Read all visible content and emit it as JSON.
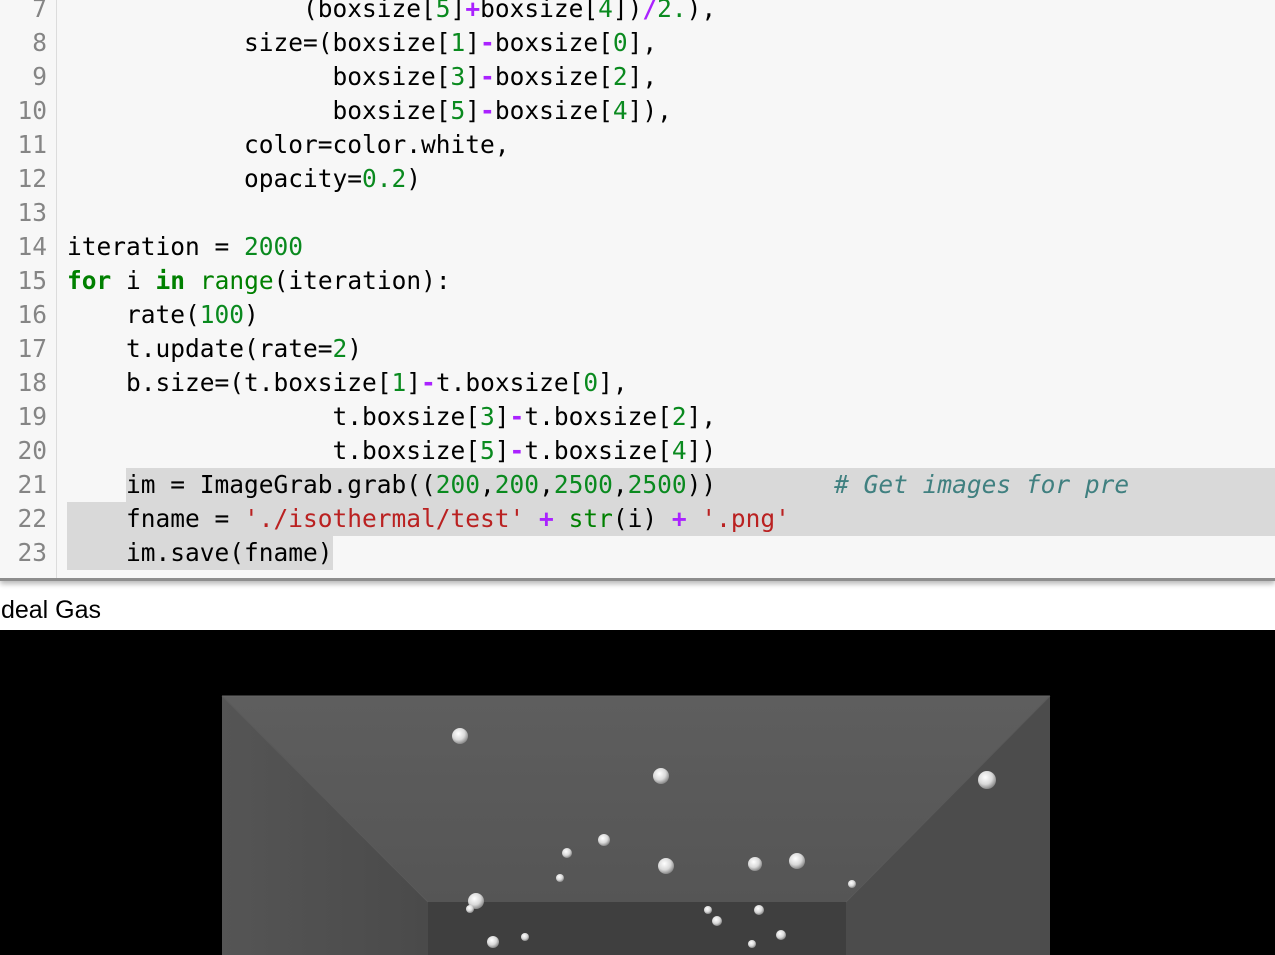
{
  "editor": {
    "lines": [
      {
        "num": "7",
        "tokens": [
          {
            "t": "                "
          },
          {
            "t": "(boxsize["
          },
          {
            "t": "5",
            "c": "n"
          },
          {
            "t": "]"
          },
          {
            "t": "+",
            "c": "o"
          },
          {
            "t": "boxsize["
          },
          {
            "t": "4",
            "c": "n"
          },
          {
            "t": "])"
          },
          {
            "t": "/",
            "c": "o"
          },
          {
            "t": "2.",
            "c": "n"
          },
          {
            "t": "),"
          }
        ]
      },
      {
        "num": "8",
        "tokens": [
          {
            "t": "            size=(boxsize["
          },
          {
            "t": "1",
            "c": "n"
          },
          {
            "t": "]"
          },
          {
            "t": "-",
            "c": "o"
          },
          {
            "t": "boxsize["
          },
          {
            "t": "0",
            "c": "n"
          },
          {
            "t": "],"
          }
        ]
      },
      {
        "num": "9",
        "tokens": [
          {
            "t": "                  boxsize["
          },
          {
            "t": "3",
            "c": "n"
          },
          {
            "t": "]"
          },
          {
            "t": "-",
            "c": "o"
          },
          {
            "t": "boxsize["
          },
          {
            "t": "2",
            "c": "n"
          },
          {
            "t": "],"
          }
        ]
      },
      {
        "num": "10",
        "tokens": [
          {
            "t": "                  boxsize["
          },
          {
            "t": "5",
            "c": "n"
          },
          {
            "t": "]"
          },
          {
            "t": "-",
            "c": "o"
          },
          {
            "t": "boxsize["
          },
          {
            "t": "4",
            "c": "n"
          },
          {
            "t": "]),"
          }
        ]
      },
      {
        "num": "11",
        "tokens": [
          {
            "t": "            color=color.white,"
          }
        ]
      },
      {
        "num": "12",
        "tokens": [
          {
            "t": "            opacity="
          },
          {
            "t": "0.2",
            "c": "n"
          },
          {
            "t": ")"
          }
        ]
      },
      {
        "num": "13",
        "tokens": []
      },
      {
        "num": "14",
        "tokens": [
          {
            "t": "iteration = "
          },
          {
            "t": "2000",
            "c": "n"
          }
        ]
      },
      {
        "num": "15",
        "tokens": [
          {
            "t": "for",
            "c": "k"
          },
          {
            "t": " i "
          },
          {
            "t": "in",
            "c": "k"
          },
          {
            "t": " "
          },
          {
            "t": "range",
            "c": "b"
          },
          {
            "t": "(iteration):"
          }
        ]
      },
      {
        "num": "16",
        "tokens": [
          {
            "t": "    rate("
          },
          {
            "t": "100",
            "c": "n"
          },
          {
            "t": ")"
          }
        ]
      },
      {
        "num": "17",
        "tokens": [
          {
            "t": "    t.update(rate="
          },
          {
            "t": "2",
            "c": "n"
          },
          {
            "t": ")"
          }
        ]
      },
      {
        "num": "18",
        "tokens": [
          {
            "t": "    b.size=(t.boxsize["
          },
          {
            "t": "1",
            "c": "n"
          },
          {
            "t": "]"
          },
          {
            "t": "-",
            "c": "o"
          },
          {
            "t": "t.boxsize["
          },
          {
            "t": "0",
            "c": "n"
          },
          {
            "t": "],"
          }
        ]
      },
      {
        "num": "19",
        "tokens": [
          {
            "t": "                  t.boxsize["
          },
          {
            "t": "3",
            "c": "n"
          },
          {
            "t": "]"
          },
          {
            "t": "-",
            "c": "o"
          },
          {
            "t": "t.boxsize["
          },
          {
            "t": "2",
            "c": "n"
          },
          {
            "t": "],"
          }
        ]
      },
      {
        "num": "20",
        "tokens": [
          {
            "t": "                  t.boxsize["
          },
          {
            "t": "5",
            "c": "n"
          },
          {
            "t": "]"
          },
          {
            "t": "-",
            "c": "o"
          },
          {
            "t": "t.boxsize["
          },
          {
            "t": "4",
            "c": "n"
          },
          {
            "t": "])"
          }
        ]
      },
      {
        "num": "21",
        "tokens": [
          {
            "t": "    im = ImageGrab.grab(("
          },
          {
            "t": "200",
            "c": "n"
          },
          {
            "t": ","
          },
          {
            "t": "200",
            "c": "n"
          },
          {
            "t": ","
          },
          {
            "t": "2500",
            "c": "n"
          },
          {
            "t": ","
          },
          {
            "t": "2500",
            "c": "n"
          },
          {
            "t": "))        "
          },
          {
            "t": "# Get images for pre",
            "c": "c"
          }
        ]
      },
      {
        "num": "22",
        "tokens": [
          {
            "t": "    fname = "
          },
          {
            "t": "'./isothermal/test'",
            "c": "s"
          },
          {
            "t": " "
          },
          {
            "t": "+",
            "c": "o"
          },
          {
            "t": " "
          },
          {
            "t": "str",
            "c": "b"
          },
          {
            "t": "(i) "
          },
          {
            "t": "+",
            "c": "o"
          },
          {
            "t": " "
          },
          {
            "t": "'.png'",
            "c": "s"
          }
        ]
      },
      {
        "num": "23",
        "tokens": [
          {
            "t": "    im.save(fname)"
          }
        ]
      }
    ],
    "selected_lines": [
      "21",
      "22",
      "23"
    ]
  },
  "output": {
    "title": "Ideal Gas"
  },
  "colors": {
    "editor_bg": "#f7f7f7",
    "keyword": "#008000",
    "number": "#0a8a1f",
    "string": "#ba2121",
    "operator": "#aa22ff",
    "comment": "#408080",
    "selection": "#d9d9d9",
    "canvas_bg": "#000000"
  }
}
